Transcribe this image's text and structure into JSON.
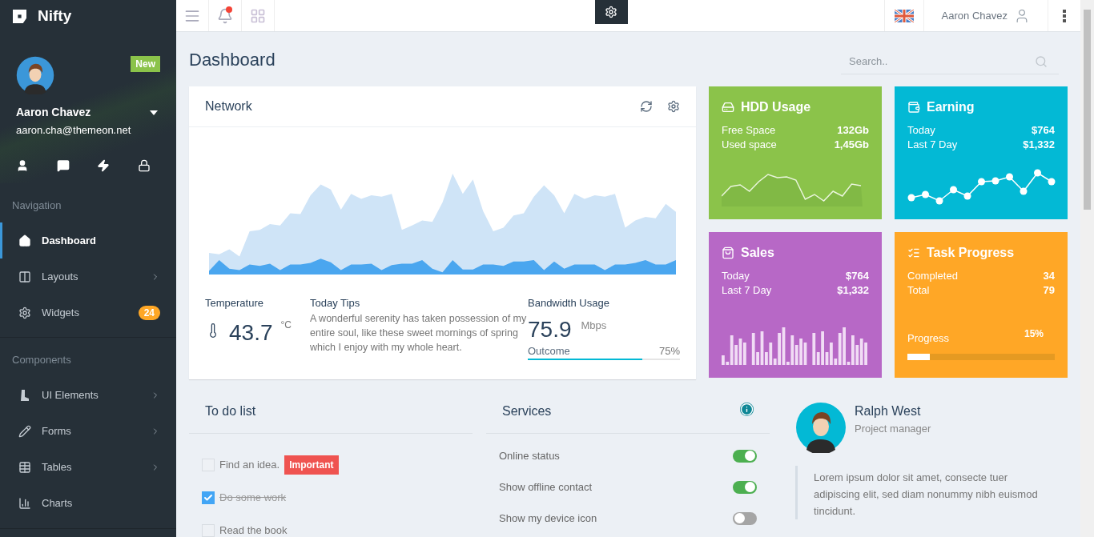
{
  "brand": "Nifty",
  "profile": {
    "name": "Aaron Chavez",
    "email": "aaron.cha@themeon.net",
    "badge": "New"
  },
  "nav_sections": [
    {
      "title": "Navigation",
      "items": [
        {
          "kind": "home",
          "label": "Dashboard",
          "selected": true,
          "submenu": false
        },
        {
          "kind": "layout",
          "label": "Layouts",
          "selected": false,
          "submenu": true
        },
        {
          "kind": "gear",
          "label": "Widgets",
          "selected": false,
          "submenu": false,
          "badge": "24"
        }
      ]
    },
    {
      "title": "Components",
      "items": [
        {
          "kind": "boot",
          "label": "UI Elements",
          "selected": false,
          "submenu": true
        },
        {
          "kind": "pencil",
          "label": "Forms",
          "selected": false,
          "submenu": true
        },
        {
          "kind": "table",
          "label": "Tables",
          "selected": false,
          "submenu": true
        },
        {
          "kind": "chart",
          "label": "Charts",
          "selected": false,
          "submenu": false
        }
      ]
    }
  ],
  "header": {
    "user": "Aaron Chavez",
    "notification_dot": true
  },
  "page_title": "Dashboard",
  "search": {
    "placeholder": "Search.."
  },
  "network": {
    "title": "Network",
    "temperature": {
      "label": "Temperature",
      "value": "43.7",
      "unit": "°C"
    },
    "tips": {
      "title": "Today Tips",
      "text": "A wonderful serenity has taken possession of my entire soul, like these sweet mornings of spring which I enjoy with my whole heart."
    },
    "bandwidth": {
      "label": "Bandwidth Usage",
      "value": "75.9",
      "unit": "Mbps",
      "outcome": "Outcome",
      "percent": "75%",
      "level": 0.75
    }
  },
  "tiles": [
    {
      "kind": "line",
      "title": "HDD Usage",
      "color": "#8bc34a",
      "rows": [
        {
          "label": "Free Space",
          "value": "132Gb"
        },
        {
          "label": "Used space",
          "value": "1,45Gb"
        }
      ]
    },
    {
      "kind": "dots",
      "title": "Earning",
      "color": "#03b9d5",
      "rows": [
        {
          "label": "Today",
          "value": "$764"
        },
        {
          "label": "Last 7 Day",
          "value": "$1,332"
        }
      ]
    },
    {
      "kind": "bars",
      "title": "Sales",
      "color": "#b768c6",
      "rows": [
        {
          "label": "Today",
          "value": "$764"
        },
        {
          "label": "Last 7 Day",
          "value": "$1,332"
        }
      ]
    },
    {
      "kind": "progress",
      "title": "Task Progress",
      "color": "#ffa726",
      "rows": [
        {
          "label": "Completed",
          "value": "34"
        },
        {
          "label": "Total",
          "value": "79"
        }
      ],
      "progress_label": "Progress",
      "progress_text": "15%",
      "level": 0.15
    }
  ],
  "todo": {
    "title": "To do list",
    "items": [
      {
        "text": "Find an idea.",
        "checked": false,
        "tag": "Important"
      },
      {
        "text": "Do some work",
        "checked": true
      },
      {
        "text": "Read the book",
        "checked": false
      }
    ]
  },
  "services": {
    "title": "Services",
    "items": [
      {
        "label": "Online status",
        "on": true
      },
      {
        "label": "Show offline contact",
        "on": true
      },
      {
        "label": "Show my device icon",
        "on": false
      }
    ]
  },
  "person": {
    "name": "Ralph West",
    "role": "Project manager",
    "quote": "Lorem ipsum dolor sit amet, consecte tuer adipiscing elit, sed diam nonummy nibh euismod tincidunt."
  }
}
